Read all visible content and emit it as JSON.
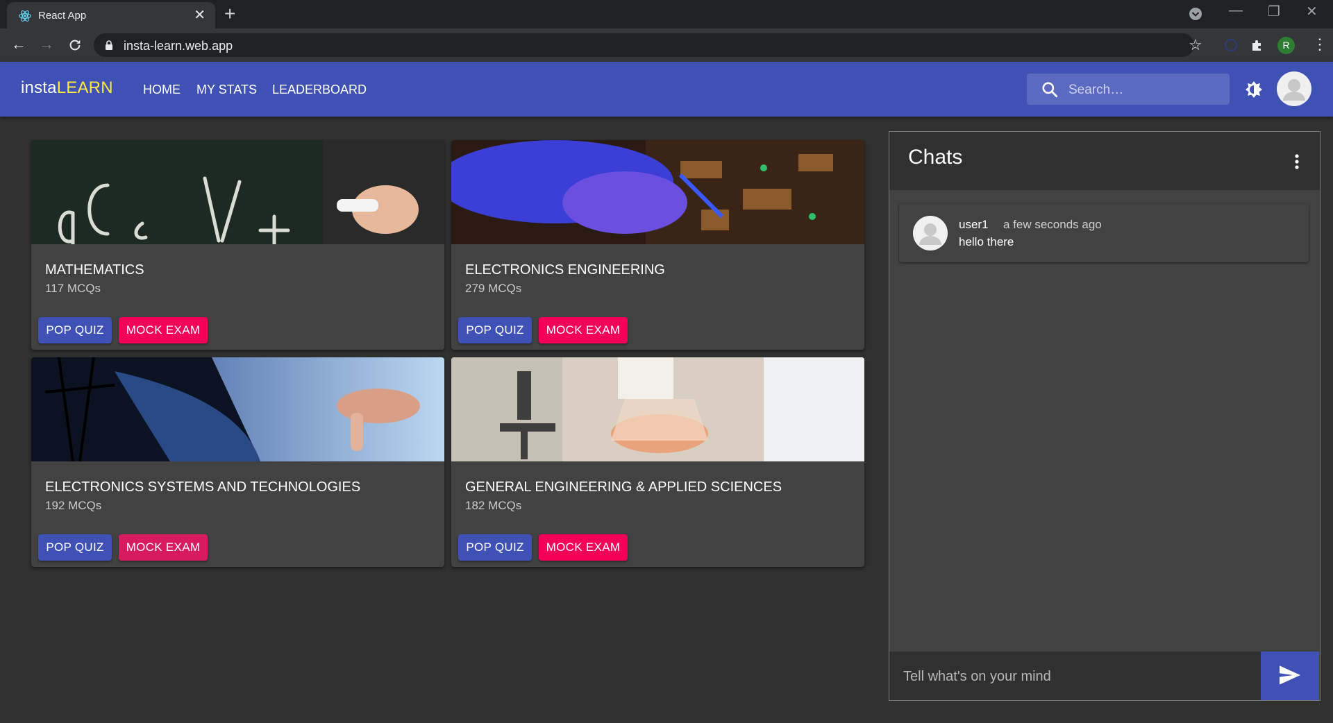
{
  "browser": {
    "tab_title": "React App",
    "url": "insta-learn.web.app",
    "profile_initial": "R"
  },
  "app": {
    "logo_part1": "insta",
    "logo_part2": "LEARN",
    "nav": [
      "HOME",
      "MY STATS",
      "LEADERBOARD"
    ],
    "search_placeholder": "Search…"
  },
  "subjects": [
    {
      "title": "MATHEMATICS",
      "count": "117 MCQs",
      "pop_label": "POP QUIZ",
      "mock_label": "MOCK EXAM"
    },
    {
      "title": "ELECTRONICS ENGINEERING",
      "count": "279 MCQs",
      "pop_label": "POP QUIZ",
      "mock_label": "MOCK EXAM"
    },
    {
      "title": "ELECTRONICS SYSTEMS AND TECHNOLOGIES",
      "count": "192 MCQs",
      "pop_label": "POP QUIZ",
      "mock_label": "MOCK EXAM"
    },
    {
      "title": "GENERAL ENGINEERING & APPLIED SCIENCES",
      "count": "182 MCQs",
      "pop_label": "POP QUIZ",
      "mock_label": "MOCK EXAM"
    }
  ],
  "chat": {
    "title": "Chats",
    "messages": [
      {
        "user": "user1",
        "time": "a few seconds ago",
        "text": "hello there"
      }
    ],
    "input_placeholder": "Tell what's on your mind"
  },
  "colors": {
    "primary": "#3f51b5",
    "secondary": "#f50057",
    "logo_accent": "#ffeb3b",
    "background": "#303030",
    "card": "#424242"
  }
}
